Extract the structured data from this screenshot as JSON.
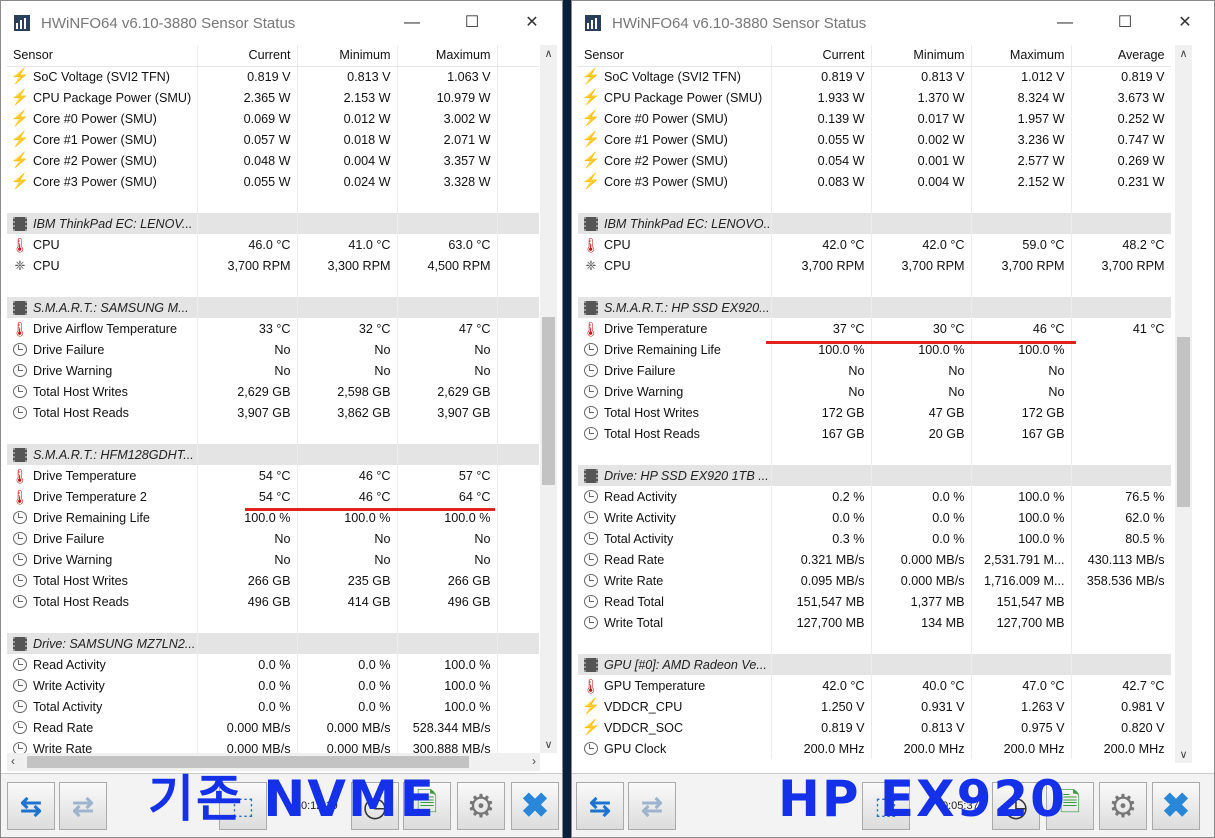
{
  "left": {
    "title": "HWiNFO64 v6.10-3880 Sensor Status",
    "columns": [
      "Sensor",
      "Current",
      "Minimum",
      "Maximum"
    ],
    "rows": [
      {
        "kind": "row",
        "icon": "bolt",
        "cells": [
          "SoC Voltage (SVI2 TFN)",
          "0.819 V",
          "0.813 V",
          "1.063 V",
          ""
        ]
      },
      {
        "kind": "row",
        "icon": "bolt",
        "cells": [
          "CPU Package Power (SMU)",
          "2.365 W",
          "2.153 W",
          "10.979 W",
          ""
        ]
      },
      {
        "kind": "row",
        "icon": "bolt",
        "cells": [
          "Core #0 Power (SMU)",
          "0.069 W",
          "0.012 W",
          "3.002 W",
          ""
        ]
      },
      {
        "kind": "row",
        "icon": "bolt",
        "cells": [
          "Core #1 Power (SMU)",
          "0.057 W",
          "0.018 W",
          "2.071 W",
          ""
        ]
      },
      {
        "kind": "row",
        "icon": "bolt",
        "cells": [
          "Core #2 Power (SMU)",
          "0.048 W",
          "0.004 W",
          "3.357 W",
          ""
        ]
      },
      {
        "kind": "row",
        "icon": "bolt",
        "cells": [
          "Core #3 Power (SMU)",
          "0.055 W",
          "0.024 W",
          "3.328 W",
          ""
        ]
      },
      {
        "kind": "blank"
      },
      {
        "kind": "group",
        "cells": [
          "IBM ThinkPad EC: LENOV..."
        ]
      },
      {
        "kind": "row",
        "icon": "therm",
        "cells": [
          "CPU",
          "46.0 °C",
          "41.0 °C",
          "63.0 °C",
          ""
        ]
      },
      {
        "kind": "row",
        "icon": "fan",
        "cells": [
          "CPU",
          "3,700 RPM",
          "3,300 RPM",
          "4,500 RPM",
          "3"
        ]
      },
      {
        "kind": "blank"
      },
      {
        "kind": "group",
        "cells": [
          "S.M.A.R.T.: SAMSUNG M..."
        ]
      },
      {
        "kind": "row",
        "icon": "therm",
        "cells": [
          "Drive Airflow Temperature",
          "33 °C",
          "32 °C",
          "47 °C",
          ""
        ]
      },
      {
        "kind": "row",
        "icon": "clock",
        "cells": [
          "Drive Failure",
          "No",
          "No",
          "No",
          ""
        ]
      },
      {
        "kind": "row",
        "icon": "clock",
        "cells": [
          "Drive Warning",
          "No",
          "No",
          "No",
          ""
        ]
      },
      {
        "kind": "row",
        "icon": "clock",
        "cells": [
          "Total Host Writes",
          "2,629 GB",
          "2,598 GB",
          "2,629 GB",
          ""
        ]
      },
      {
        "kind": "row",
        "icon": "clock",
        "cells": [
          "Total Host Reads",
          "3,907 GB",
          "3,862 GB",
          "3,907 GB",
          ""
        ]
      },
      {
        "kind": "blank"
      },
      {
        "kind": "group",
        "cells": [
          "S.M.A.R.T.: HFM128GDHT..."
        ]
      },
      {
        "kind": "row",
        "icon": "therm",
        "cells": [
          "Drive Temperature",
          "54 °C",
          "46 °C",
          "57 °C",
          ""
        ]
      },
      {
        "kind": "row",
        "icon": "therm",
        "cells": [
          "Drive Temperature 2",
          "54 °C",
          "46 °C",
          "64 °C",
          ""
        ]
      },
      {
        "kind": "row",
        "icon": "clock",
        "cells": [
          "Drive Remaining Life",
          "100.0 %",
          "100.0 %",
          "100.0 %",
          ""
        ]
      },
      {
        "kind": "row",
        "icon": "clock",
        "cells": [
          "Drive Failure",
          "No",
          "No",
          "No",
          ""
        ]
      },
      {
        "kind": "row",
        "icon": "clock",
        "cells": [
          "Drive Warning",
          "No",
          "No",
          "No",
          ""
        ]
      },
      {
        "kind": "row",
        "icon": "clock",
        "cells": [
          "Total Host Writes",
          "266 GB",
          "235 GB",
          "266 GB",
          ""
        ]
      },
      {
        "kind": "row",
        "icon": "clock",
        "cells": [
          "Total Host Reads",
          "496 GB",
          "414 GB",
          "496 GB",
          ""
        ]
      },
      {
        "kind": "blank"
      },
      {
        "kind": "group",
        "cells": [
          "Drive: SAMSUNG MZ7LN2..."
        ]
      },
      {
        "kind": "row",
        "icon": "clock",
        "cells": [
          "Read Activity",
          "0.0 %",
          "0.0 %",
          "100.0 %",
          ""
        ]
      },
      {
        "kind": "row",
        "icon": "clock",
        "cells": [
          "Write Activity",
          "0.0 %",
          "0.0 %",
          "100.0 %",
          ""
        ]
      },
      {
        "kind": "row",
        "icon": "clock",
        "cells": [
          "Total Activity",
          "0.0 %",
          "0.0 %",
          "100.0 %",
          ""
        ]
      },
      {
        "kind": "row",
        "icon": "clock",
        "cells": [
          "Read Rate",
          "0.000 MB/s",
          "0.000 MB/s",
          "528.344 MB/s",
          "63."
        ]
      },
      {
        "kind": "row",
        "icon": "clock",
        "cells": [
          "Write Rate",
          "0.000 MB/s",
          "0.000 MB/s",
          "300.888 MB/s",
          "44"
        ]
      }
    ],
    "timer": "0:12:19",
    "overlay": "기존 NVME"
  },
  "right": {
    "title": "HWiNFO64 v6.10-3880 Sensor Status",
    "columns": [
      "Sensor",
      "Current",
      "Minimum",
      "Maximum",
      "Average"
    ],
    "rows": [
      {
        "kind": "row",
        "icon": "bolt",
        "cells": [
          "SoC Voltage (SVI2 TFN)",
          "0.819 V",
          "0.813 V",
          "1.012 V",
          "0.819 V"
        ]
      },
      {
        "kind": "row",
        "icon": "bolt",
        "cells": [
          "CPU Package Power (SMU)",
          "1.933 W",
          "1.370 W",
          "8.324 W",
          "3.673 W"
        ]
      },
      {
        "kind": "row",
        "icon": "bolt",
        "cells": [
          "Core #0 Power (SMU)",
          "0.139 W",
          "0.017 W",
          "1.957 W",
          "0.252 W"
        ]
      },
      {
        "kind": "row",
        "icon": "bolt",
        "cells": [
          "Core #1 Power (SMU)",
          "0.055 W",
          "0.002 W",
          "3.236 W",
          "0.747 W"
        ]
      },
      {
        "kind": "row",
        "icon": "bolt",
        "cells": [
          "Core #2 Power (SMU)",
          "0.054 W",
          "0.001 W",
          "2.577 W",
          "0.269 W"
        ]
      },
      {
        "kind": "row",
        "icon": "bolt",
        "cells": [
          "Core #3 Power (SMU)",
          "0.083 W",
          "0.004 W",
          "2.152 W",
          "0.231 W"
        ]
      },
      {
        "kind": "blank"
      },
      {
        "kind": "group",
        "cells": [
          "IBM ThinkPad EC: LENOVO..."
        ]
      },
      {
        "kind": "row",
        "icon": "therm",
        "cells": [
          "CPU",
          "42.0 °C",
          "42.0 °C",
          "59.0 °C",
          "48.2 °C"
        ]
      },
      {
        "kind": "row",
        "icon": "fan",
        "cells": [
          "CPU",
          "3,700 RPM",
          "3,700 RPM",
          "3,700 RPM",
          "3,700 RPM"
        ]
      },
      {
        "kind": "blank"
      },
      {
        "kind": "group",
        "cells": [
          "S.M.A.R.T.: HP SSD EX920..."
        ]
      },
      {
        "kind": "row",
        "icon": "therm",
        "cells": [
          "Drive Temperature",
          "37 °C",
          "30 °C",
          "46 °C",
          "41 °C"
        ]
      },
      {
        "kind": "row",
        "icon": "clock",
        "cells": [
          "Drive Remaining Life",
          "100.0 %",
          "100.0 %",
          "100.0 %",
          ""
        ]
      },
      {
        "kind": "row",
        "icon": "clock",
        "cells": [
          "Drive Failure",
          "No",
          "No",
          "No",
          ""
        ]
      },
      {
        "kind": "row",
        "icon": "clock",
        "cells": [
          "Drive Warning",
          "No",
          "No",
          "No",
          ""
        ]
      },
      {
        "kind": "row",
        "icon": "clock",
        "cells": [
          "Total Host Writes",
          "172 GB",
          "47 GB",
          "172 GB",
          ""
        ]
      },
      {
        "kind": "row",
        "icon": "clock",
        "cells": [
          "Total Host Reads",
          "167 GB",
          "20 GB",
          "167 GB",
          ""
        ]
      },
      {
        "kind": "blank"
      },
      {
        "kind": "group",
        "cells": [
          "Drive: HP SSD EX920 1TB ..."
        ]
      },
      {
        "kind": "row",
        "icon": "clock",
        "cells": [
          "Read Activity",
          "0.2 %",
          "0.0 %",
          "100.0 %",
          "76.5 %"
        ]
      },
      {
        "kind": "row",
        "icon": "clock",
        "cells": [
          "Write Activity",
          "0.0 %",
          "0.0 %",
          "100.0 %",
          "62.0 %"
        ]
      },
      {
        "kind": "row",
        "icon": "clock",
        "cells": [
          "Total Activity",
          "0.3 %",
          "0.0 %",
          "100.0 %",
          "80.5 %"
        ]
      },
      {
        "kind": "row",
        "icon": "clock",
        "cells": [
          "Read Rate",
          "0.321 MB/s",
          "0.000 MB/s",
          "2,531.791 M...",
          "430.113 MB/s"
        ]
      },
      {
        "kind": "row",
        "icon": "clock",
        "cells": [
          "Write Rate",
          "0.095 MB/s",
          "0.000 MB/s",
          "1,716.009 M...",
          "358.536 MB/s"
        ]
      },
      {
        "kind": "row",
        "icon": "clock",
        "cells": [
          "Read Total",
          "151,547 MB",
          "1,377 MB",
          "151,547 MB",
          ""
        ]
      },
      {
        "kind": "row",
        "icon": "clock",
        "cells": [
          "Write Total",
          "127,700 MB",
          "134 MB",
          "127,700 MB",
          ""
        ]
      },
      {
        "kind": "blank"
      },
      {
        "kind": "group",
        "cells": [
          "GPU [#0]: AMD Radeon Ve..."
        ]
      },
      {
        "kind": "row",
        "icon": "therm",
        "cells": [
          "GPU Temperature",
          "42.0 °C",
          "40.0 °C",
          "47.0 °C",
          "42.7 °C"
        ]
      },
      {
        "kind": "row",
        "icon": "bolt",
        "cells": [
          "VDDCR_CPU",
          "1.250 V",
          "0.931 V",
          "1.263 V",
          "0.981 V"
        ]
      },
      {
        "kind": "row",
        "icon": "bolt",
        "cells": [
          "VDDCR_SOC",
          "0.819 V",
          "0.813 V",
          "0.975 V",
          "0.820 V"
        ]
      },
      {
        "kind": "row",
        "icon": "clock",
        "cells": [
          "GPU Clock",
          "200.0 MHz",
          "200.0 MHz",
          "200.0 MHz",
          "200.0 MHz"
        ]
      }
    ],
    "timer": "0:05:37",
    "overlay": "HP EX920"
  },
  "colors": {
    "accent": "#1d74d0",
    "highlight_line": "#e0241b",
    "overlay_text": "#1430e8",
    "group_bg": "#e4e4e4"
  },
  "icons": {
    "bolt": "power-icon",
    "therm": "thermometer-icon",
    "fan": "fan-icon",
    "clock": "gauge-icon",
    "chip": "chip-icon"
  }
}
